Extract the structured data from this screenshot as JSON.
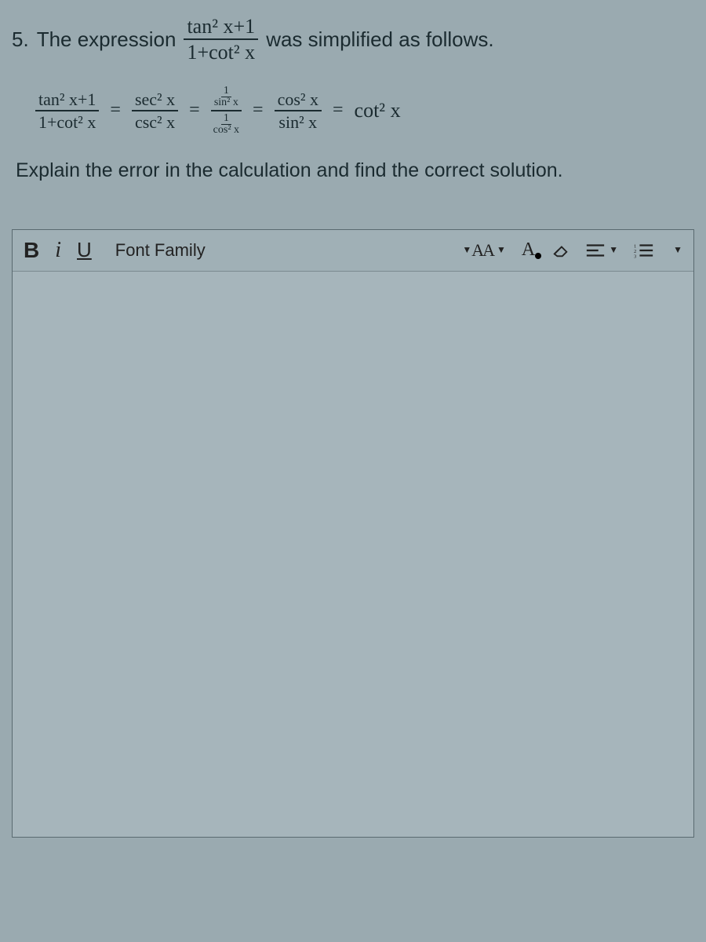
{
  "question": {
    "number": "5.",
    "text_before": "The expression",
    "frac_main_num": "tan² x+1",
    "frac_main_den": "1+cot² x",
    "text_after": "was simplified as follows.",
    "work": {
      "step1_num": "tan² x+1",
      "step1_den": "1+cot² x",
      "step2_num": "sec² x",
      "step2_den": "csc² x",
      "step3_top_num": "1",
      "step3_top_den": "sin² x",
      "step3_bot_num": "1",
      "step3_bot_den": "cos² x",
      "step4_num": "cos² x",
      "step4_den": "sin² x",
      "result": "cot² x",
      "eq": "="
    },
    "prompt": "Explain the error in the calculation and find the correct solution."
  },
  "toolbar": {
    "bold": "B",
    "italic": "i",
    "underline": "U",
    "font_family": "Font Family",
    "size_label": "AA",
    "color_label": "A"
  }
}
